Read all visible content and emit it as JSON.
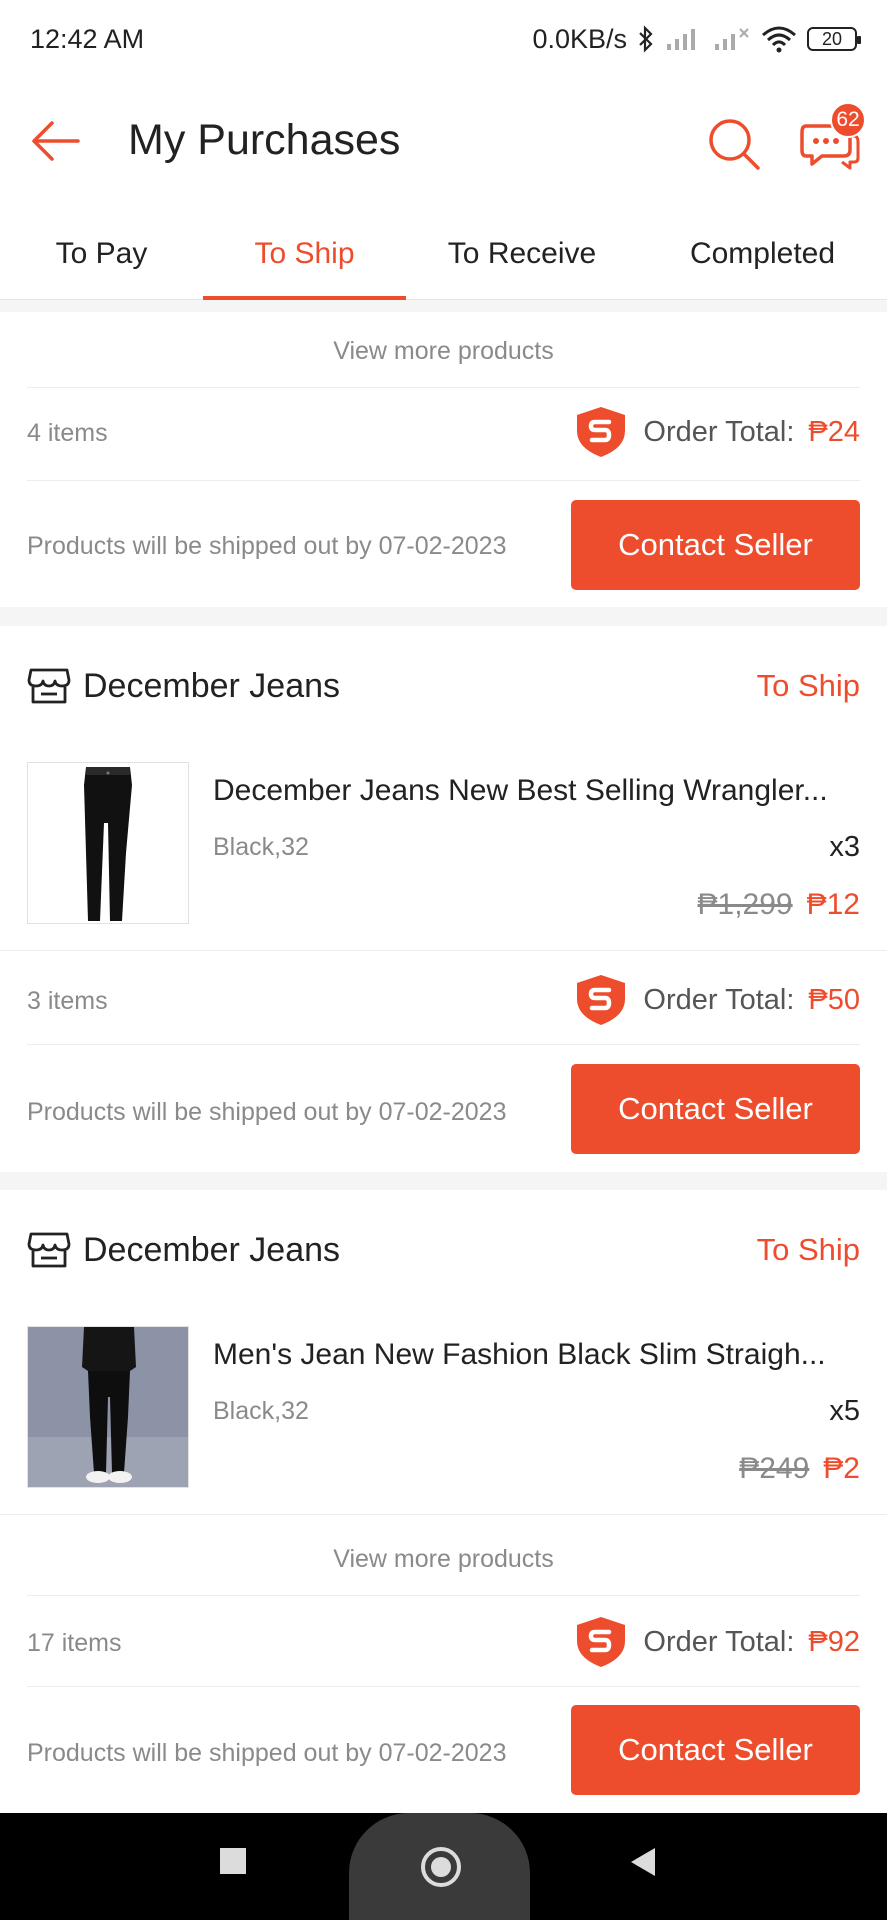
{
  "status_bar": {
    "time": "12:42 AM",
    "network_speed": "0.0KB/s",
    "battery": "20",
    "icons": [
      "bluetooth-icon",
      "signal-icon",
      "signal-x-icon",
      "wifi-icon",
      "battery-icon"
    ]
  },
  "header": {
    "title": "My Purchases",
    "chat_badge": "62",
    "icons": [
      "back-arrow-icon",
      "search-icon",
      "chat-icon"
    ]
  },
  "tabs": [
    {
      "label": "To Pay",
      "active": false
    },
    {
      "label": "To Ship",
      "active": true
    },
    {
      "label": "To Receive",
      "active": false
    },
    {
      "label": "Completed",
      "active": false
    }
  ],
  "orders": [
    {
      "view_more": "View more products",
      "items_count": "4 items",
      "total_label": "Order Total: ",
      "total_amount": "₱24",
      "ship_note": "Products will be shipped out by 07-02-2023",
      "contact_label": "Contact Seller"
    },
    {
      "shop_name": "December Jeans",
      "status": "To Ship",
      "product": {
        "name": "December Jeans New Best Selling Wrangler...",
        "variant": "Black,32",
        "qty": "x3",
        "old_price": "₱1,299",
        "new_price": "₱12"
      },
      "items_count": "3 items",
      "total_label": "Order Total: ",
      "total_amount": "₱50",
      "ship_note": "Products will be shipped out by 07-02-2023",
      "contact_label": "Contact Seller"
    },
    {
      "shop_name": "December Jeans",
      "status": "To Ship",
      "product": {
        "name": "Men's Jean New Fashion Black Slim Straigh...",
        "variant": "Black,32",
        "qty": "x5",
        "old_price": "₱249",
        "new_price": "₱2"
      },
      "view_more": "View more products",
      "items_count": "17 items",
      "total_label": "Order Total: ",
      "total_amount": "₱92",
      "ship_note": "Products will be shipped out by 07-02-2023",
      "contact_label": "Contact Seller"
    }
  ],
  "nav_bar": {
    "icons": [
      "recents-square-icon",
      "home-circle-icon",
      "back-triangle-icon"
    ]
  },
  "colors": {
    "accent": "#ee4d2d",
    "muted_text": "#8a8a8a",
    "background": "#f5f5f5"
  }
}
